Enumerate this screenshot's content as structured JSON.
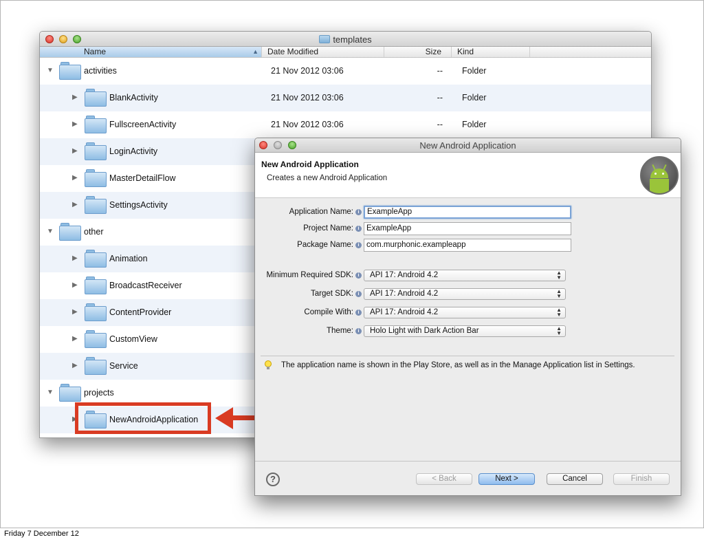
{
  "finder": {
    "title": "templates",
    "columns": {
      "name": "Name",
      "date": "Date Modified",
      "size": "Size",
      "kind": "Kind"
    },
    "rows": [
      {
        "name": "activities",
        "date": "21 Nov 2012 03:06",
        "size": "--",
        "kind": "Folder",
        "level": 0,
        "expanded": true
      },
      {
        "name": "BlankActivity",
        "date": "21 Nov 2012 03:06",
        "size": "--",
        "kind": "Folder",
        "level": 1,
        "expanded": false
      },
      {
        "name": "FullscreenActivity",
        "date": "21 Nov 2012 03:06",
        "size": "--",
        "kind": "Folder",
        "level": 1,
        "expanded": false
      },
      {
        "name": "LoginActivity",
        "date": "",
        "size": "",
        "kind": "",
        "level": 1,
        "expanded": false
      },
      {
        "name": "MasterDetailFlow",
        "date": "",
        "size": "",
        "kind": "",
        "level": 1,
        "expanded": false
      },
      {
        "name": "SettingsActivity",
        "date": "",
        "size": "",
        "kind": "",
        "level": 1,
        "expanded": false
      },
      {
        "name": "other",
        "date": "",
        "size": "",
        "kind": "",
        "level": 0,
        "expanded": true
      },
      {
        "name": "Animation",
        "date": "",
        "size": "",
        "kind": "",
        "level": 1,
        "expanded": false
      },
      {
        "name": "BroadcastReceiver",
        "date": "",
        "size": "",
        "kind": "",
        "level": 1,
        "expanded": false
      },
      {
        "name": "ContentProvider",
        "date": "",
        "size": "",
        "kind": "",
        "level": 1,
        "expanded": false
      },
      {
        "name": "CustomView",
        "date": "",
        "size": "",
        "kind": "",
        "level": 1,
        "expanded": false
      },
      {
        "name": "Service",
        "date": "",
        "size": "",
        "kind": "",
        "level": 1,
        "expanded": false
      },
      {
        "name": "projects",
        "date": "",
        "size": "",
        "kind": "",
        "level": 0,
        "expanded": true
      },
      {
        "name": "NewAndroidApplication",
        "date": "",
        "size": "",
        "kind": "",
        "level": 1,
        "expanded": false
      }
    ]
  },
  "dialog": {
    "title": "New Android Application",
    "banner_title": "New Android Application",
    "banner_subtitle": "Creates a new Android Application",
    "fields": {
      "app_name": {
        "label": "Application Name:",
        "value": "ExampleApp"
      },
      "project_name": {
        "label": "Project Name:",
        "value": "ExampleApp"
      },
      "package_name": {
        "label": "Package Name:",
        "value": "com.murphonic.exampleapp"
      }
    },
    "selects": {
      "min_sdk": {
        "label": "Minimum Required SDK:",
        "value": "API 17: Android 4.2"
      },
      "target_sdk": {
        "label": "Target SDK:",
        "value": "API 17: Android 4.2"
      },
      "compile_with": {
        "label": "Compile With:",
        "value": "API 17: Android 4.2"
      },
      "theme": {
        "label": "Theme:",
        "value": "Holo Light with Dark Action Bar"
      }
    },
    "hint": "The application name is shown in the Play Store, as well as in the Manage Application list in Settings.",
    "buttons": {
      "back": "< Back",
      "next": "Next >",
      "cancel": "Cancel",
      "finish": "Finish"
    },
    "help_symbol": "?",
    "info_symbol": "i"
  },
  "footer": "Friday 7 December 12",
  "colors": {
    "highlight": "#d93b23",
    "selection": "#a9cbe9"
  }
}
